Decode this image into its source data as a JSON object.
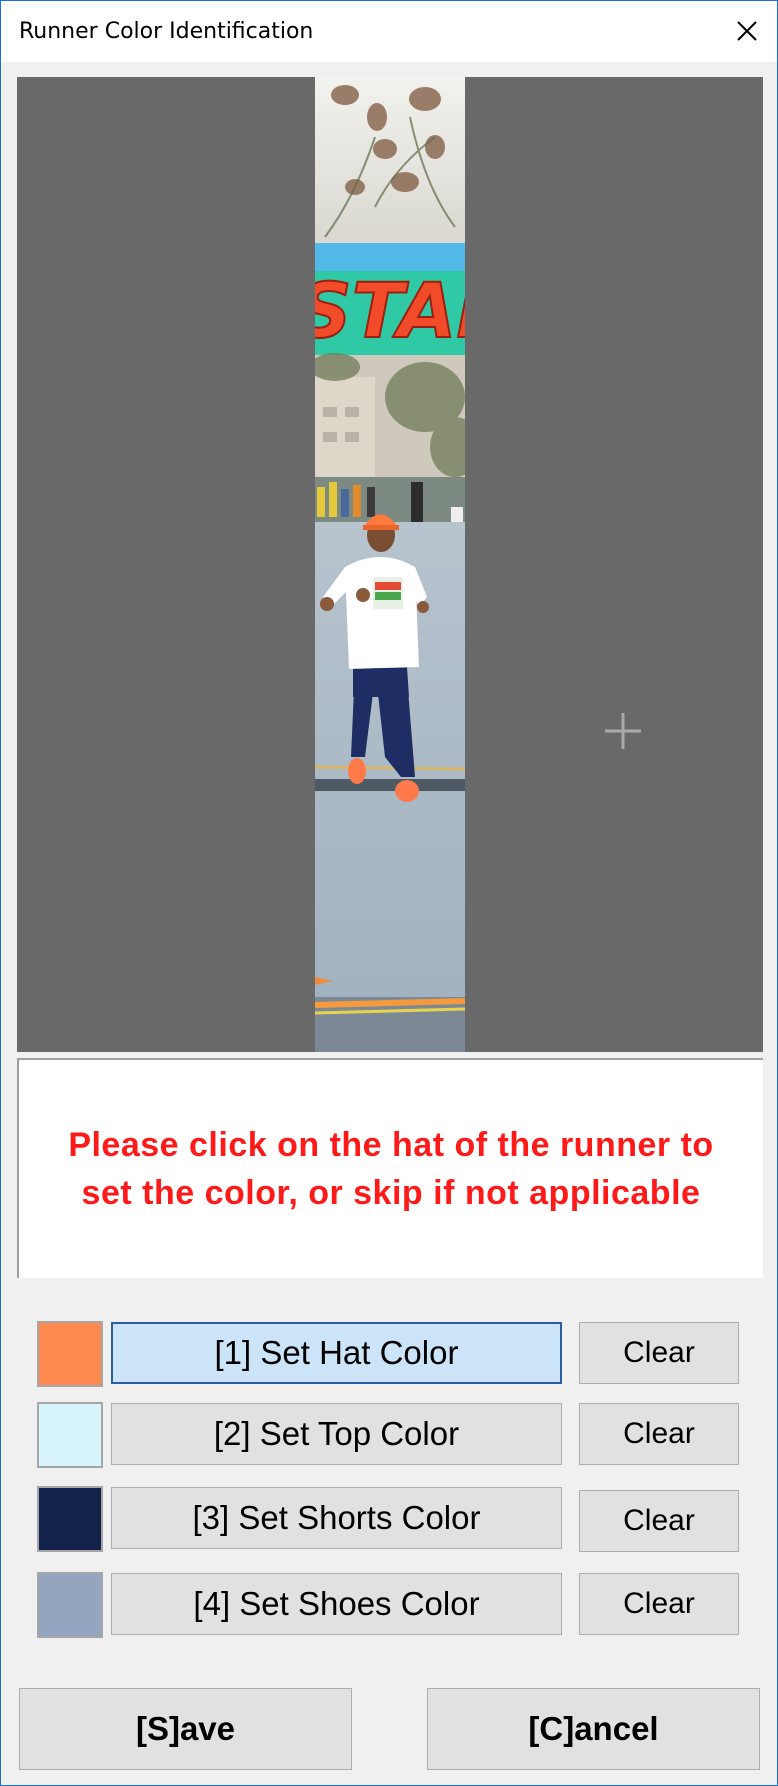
{
  "window": {
    "title": "Runner Color Identification"
  },
  "icons": {
    "close": "close-icon",
    "crosshair": "crosshair-icon"
  },
  "message": {
    "line1": "Please click on the hat of the runner to",
    "line2": "set the color, or skip if not applicable",
    "color": "#ff1a1a"
  },
  "colors": {
    "accent": "#2a5fa6",
    "canvas": "#696969"
  },
  "rows": [
    {
      "set_label": "[1] Set Hat Color",
      "clear_label": "Clear",
      "swatch": "#ff8a50",
      "active": true
    },
    {
      "set_label": "[2] Set Top Color",
      "clear_label": "Clear",
      "swatch": "#d8f4fc",
      "active": false
    },
    {
      "set_label": "[3] Set Shorts Color",
      "clear_label": "Clear",
      "swatch": "#13224a",
      "active": false
    },
    {
      "set_label": "[4] Set Shoes Color",
      "clear_label": "Clear",
      "swatch": "#93a5bf",
      "active": false
    }
  ],
  "footer": {
    "save_label": "[S]ave",
    "cancel_label": "[C]ancel"
  }
}
